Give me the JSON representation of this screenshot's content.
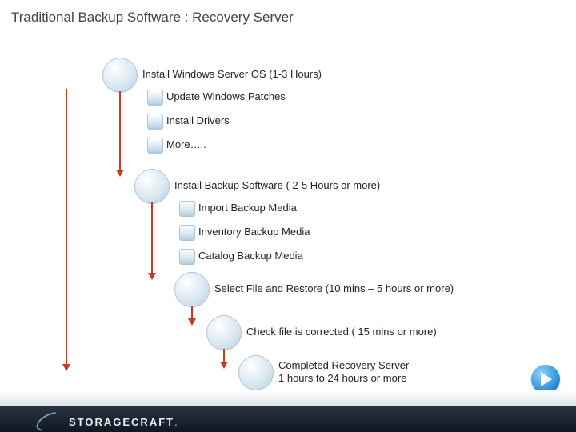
{
  "title": "Traditional Backup Software : Recovery Server",
  "steps": {
    "s1": "Install Windows Server OS (1-3 Hours)",
    "s1a": "Update Windows Patches",
    "s1b": "Install Drivers",
    "s1c": "More…..",
    "s2": "Install Backup Software ( 2-5 Hours or more)",
    "s2a": "Import Backup Media",
    "s2b": "Inventory Backup Media",
    "s2c": "Catalog Backup Media",
    "s3": "Select File and Restore (10 mins – 5 hours or more)",
    "s4": "Check file is corrected ( 15 mins or more)",
    "s5": "Completed Recovery Server\n1 hours to 24 hours or more"
  },
  "brand": {
    "name": "STORAGECRAFT",
    "suffix": "."
  },
  "colors": {
    "arrow": "#c83a1f",
    "node_fill": "#d6e6f0",
    "node_border": "#b0c4d6"
  }
}
